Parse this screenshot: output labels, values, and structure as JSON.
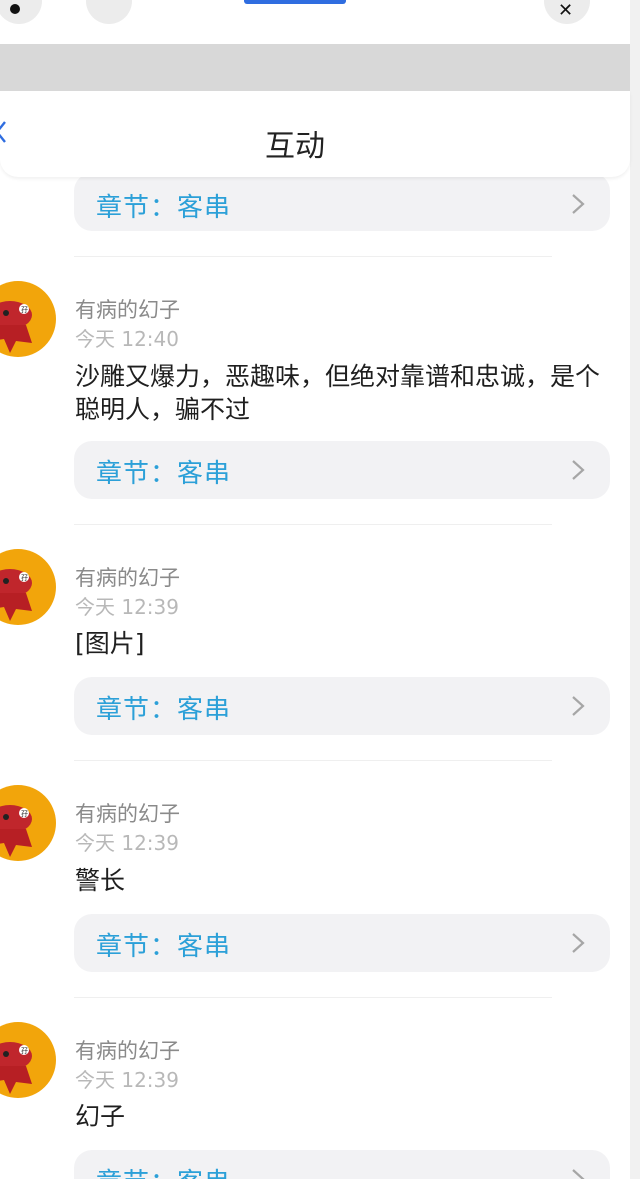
{
  "header": {
    "title": "互动"
  },
  "chapter_label": "章节：客串",
  "comments": [
    {
      "user": "有病的幻子",
      "time": "今天 12:40",
      "text": "沙雕又爆力，恶趣味，但绝对靠谱和忠诚，是个聪明人，骗不过"
    },
    {
      "user": "有病的幻子",
      "time": "今天 12:39",
      "text": "[图片]"
    },
    {
      "user": "有病的幻子",
      "time": "今天 12:39",
      "text": "警长"
    },
    {
      "user": "有病的幻子",
      "time": "今天 12:39",
      "text": "幻子"
    }
  ],
  "colors": {
    "accent": "#2ca0d8",
    "avatar_bg": "#f2a50b",
    "pill_bg": "#f2f2f4"
  },
  "icons": {
    "back": "chevron-left-icon",
    "chapter": "chevron-right-icon",
    "close": "close-icon"
  }
}
